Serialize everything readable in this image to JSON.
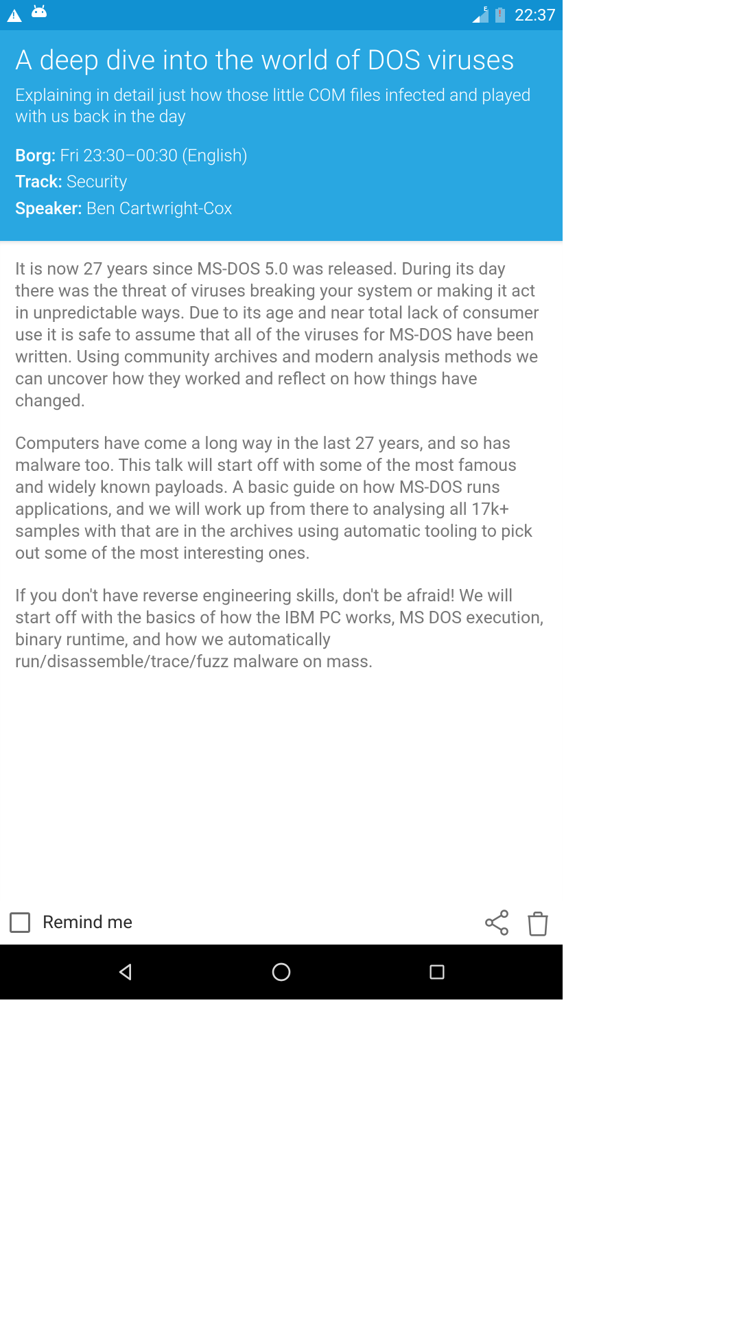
{
  "status": {
    "signal_type": "E",
    "time": "22:37"
  },
  "header": {
    "title": "A deep dive into the world of DOS viruses",
    "subtitle": "Explaining in detail just how those little COM files infected and played with us back in the day",
    "room_label": "Borg:",
    "room_value": " Fri 23:30–00:30 (English)",
    "track_label": "Track:",
    "track_value": " Security",
    "speaker_label": "Speaker:",
    "speaker_value": " Ben Cartwright-Cox"
  },
  "content": {
    "p1": "It is now 27 years since MS-DOS 5.0 was released. During its day there was the threat of viruses breaking your system or making it act in unpredictable ways. Due to its age and near total lack of consumer use it is safe to assume that all of the viruses for MS-DOS have been written. Using community archives and modern analysis methods we can uncover how they worked and reflect on how things have changed.",
    "p2": "Computers have come a long way in the last 27 years, and so has malware too. This talk will start off with some of the most famous and widely known payloads. A basic guide on how MS-DOS runs applications, and we will work up from there to analysing all 17k+ samples with that are in the archives using automatic tooling to pick out some of the most interesting ones.",
    "p3": "If you don't have reverse engineering skills, don't be afraid! We will start off with the basics of how the IBM PC works, MS DOS execution, binary runtime, and how we automatically run/disassemble/trace/fuzz malware on mass."
  },
  "bottom": {
    "remind_label": "Remind me"
  }
}
